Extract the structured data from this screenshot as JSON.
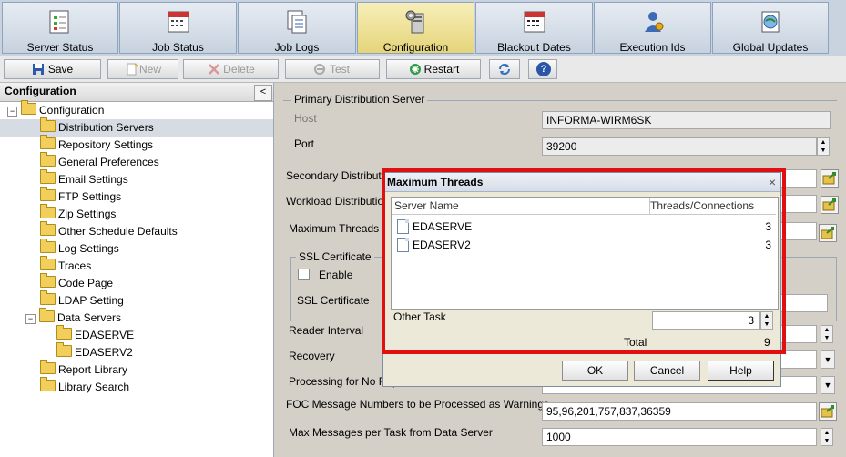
{
  "tabs": [
    {
      "label": "Server Status",
      "icon": "server-status-icon"
    },
    {
      "label": "Job Status",
      "icon": "calendar-icon"
    },
    {
      "label": "Job Logs",
      "icon": "log-icon"
    },
    {
      "label": "Configuration",
      "icon": "configuration-icon",
      "active": true
    },
    {
      "label": "Blackout Dates",
      "icon": "calendar-icon"
    },
    {
      "label": "Execution Ids",
      "icon": "user-gear-icon"
    },
    {
      "label": "Global Updates",
      "icon": "globe-update-icon"
    }
  ],
  "toolbar": {
    "save": "Save",
    "new": "New",
    "delete": "Delete",
    "test": "Test",
    "restart": "Restart",
    "help_glyph": "?"
  },
  "left_panel": {
    "title": "Configuration",
    "collapse_glyph": "<",
    "tree": [
      {
        "label": "Configuration",
        "level": 0,
        "expander": "−"
      },
      {
        "label": "Distribution Servers",
        "level": 1,
        "selected": true
      },
      {
        "label": "Repository Settings",
        "level": 1
      },
      {
        "label": "General Preferences",
        "level": 1
      },
      {
        "label": "Email Settings",
        "level": 1
      },
      {
        "label": "FTP Settings",
        "level": 1
      },
      {
        "label": "Zip Settings",
        "level": 1
      },
      {
        "label": "Other Schedule Defaults",
        "level": 1
      },
      {
        "label": "Log Settings",
        "level": 1
      },
      {
        "label": "Traces",
        "level": 1
      },
      {
        "label": "Code Page",
        "level": 1
      },
      {
        "label": "LDAP Setting",
        "level": 1
      },
      {
        "label": "Data Servers",
        "level": 1,
        "expander": "−"
      },
      {
        "label": "EDASERVE",
        "level": 2
      },
      {
        "label": "EDASERV2",
        "level": 2
      },
      {
        "label": "Report Library",
        "level": 1
      },
      {
        "label": "Library Search",
        "level": 1
      }
    ]
  },
  "form": {
    "primary_legend": "Primary Distribution Server",
    "host_label": "Host",
    "host_value": "INFORMA-WIRM6SK",
    "port_label": "Port",
    "port_value": "39200",
    "secondary_label": "Secondary Distribution",
    "workload_label": "Workload Distribution",
    "max_threads_label": "Maximum Threads",
    "ssl_legend": "SSL Certificate",
    "enable_label": "Enable",
    "ssl_cert_label": "SSL Certificate",
    "reader_label": "Reader Interval",
    "recovery_label": "Recovery",
    "processing_label": "Processing for No Rep",
    "foc_label": "FOC Message Numbers to be Processed as Warnings",
    "foc_value": "95,96,201,757,837,36359",
    "maxmsg_label": "Max Messages per Task from Data Server",
    "maxmsg_value": "1000"
  },
  "dialog": {
    "title": "Maximum Threads",
    "close_glyph": "×",
    "col_server": "Server Name",
    "col_threads": "Threads/Connections",
    "rows": [
      {
        "name": "EDASERVE",
        "threads": "3"
      },
      {
        "name": "EDASERV2",
        "threads": "3"
      }
    ],
    "other_task_label": "Other Task",
    "other_task_value": "3",
    "total_label": "Total",
    "total_value": "9",
    "ok": "OK",
    "cancel": "Cancel",
    "help": "Help"
  },
  "colors": {
    "highlight_border": "#e01010",
    "active_tab": "#f0e39a"
  }
}
